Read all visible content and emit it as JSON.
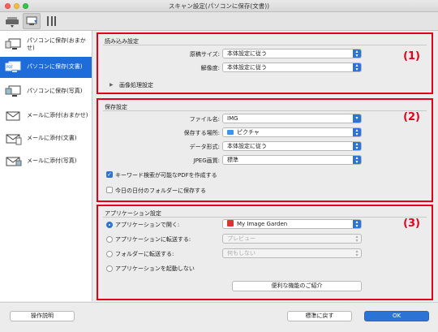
{
  "window": {
    "title": "スキャン設定(パソコンに保存(文書))"
  },
  "toolbar": {
    "icons": [
      "scanner-tab-icon",
      "pc-save-tab-icon",
      "tools-tab-icon"
    ]
  },
  "sidebar": {
    "items": [
      {
        "label": "パソコンに保存(おまかせ)",
        "icon": "pc-auto-icon",
        "selected": false
      },
      {
        "label": "パソコンに保存(文書)",
        "icon": "pc-document-icon",
        "selected": true
      },
      {
        "label": "パソコンに保存(写真)",
        "icon": "pc-photo-icon",
        "selected": false
      },
      {
        "label": "メールに添付(おまかせ)",
        "icon": "mail-auto-icon",
        "selected": false
      },
      {
        "label": "メールに添付(文書)",
        "icon": "mail-document-icon",
        "selected": false
      },
      {
        "label": "メールに添付(写真)",
        "icon": "mail-photo-icon",
        "selected": false
      }
    ]
  },
  "scan_settings": {
    "title": "読み込み設定",
    "number": "(1)",
    "doc_size_label": "原稿サイズ:",
    "doc_size_value": "本体設定に従う",
    "resolution_label": "解像度:",
    "resolution_value": "本体設定に従う",
    "image_processing_label": "画像処理設定"
  },
  "save_settings": {
    "title": "保存設定",
    "number": "(2)",
    "filename_label": "ファイル名:",
    "filename_value": "IMG",
    "location_label": "保存する場所:",
    "location_value": "ピクチャ",
    "format_label": "データ形式:",
    "format_value": "本体設定に従う",
    "jpeg_label": "JPEG画質:",
    "jpeg_value": "標準",
    "keyword_pdf_label": "キーワード検索が可能なPDFを作成する",
    "keyword_pdf_checked": true,
    "date_folder_label": "今日の日付のフォルダーに保存する",
    "date_folder_checked": false
  },
  "app_settings": {
    "title": "アプリケーション設定",
    "number": "(3)",
    "open_app_label": "アプリケーションで開く:",
    "open_app_value": "My Image Garden",
    "send_app_label": "アプリケーションに転送する:",
    "send_app_value": "プレビュー",
    "send_folder_label": "フォルダーに転送する:",
    "send_folder_value": "何もしない",
    "no_app_label": "アプリケーションを起動しない",
    "selected_option": "open_app",
    "useful_button": "便利な機能のご紹介"
  },
  "footer": {
    "help_button": "操作説明",
    "defaults_button": "標準に戻す",
    "ok_button": "OK"
  },
  "colors": {
    "accent": "#2c73d6",
    "highlight_border": "#e3001a",
    "selection": "#1d6cd9"
  }
}
